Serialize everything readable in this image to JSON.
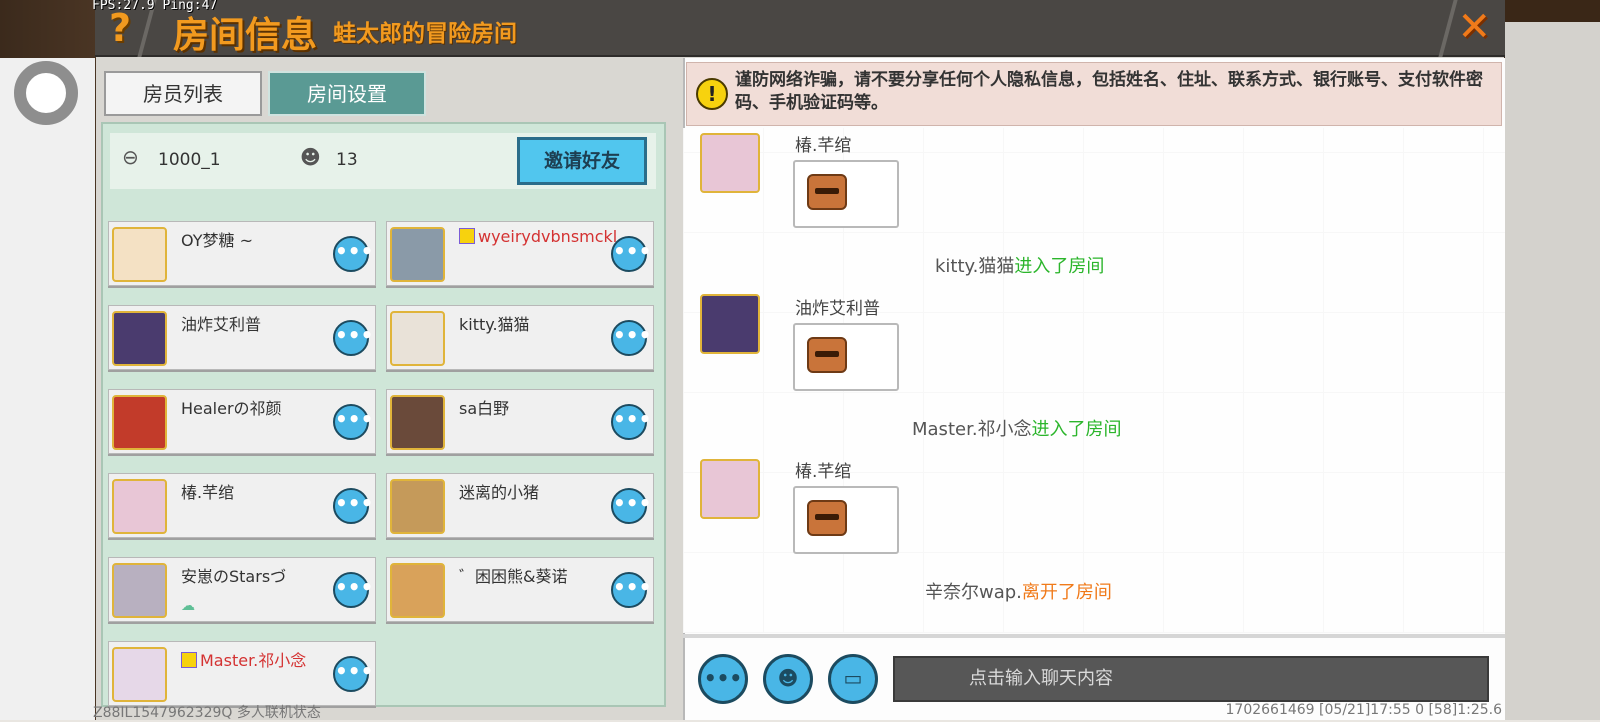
{
  "hud": {
    "fps": "FPS:27.9  Ping:47"
  },
  "titlebar": {
    "help": "?",
    "title": "房间信息",
    "room_name": "蛙太郎的冒险房间",
    "close": "✕"
  },
  "tabs": [
    {
      "label": "房员列表"
    },
    {
      "label": "房间设置"
    }
  ],
  "room_info": {
    "room_id": "1000_1",
    "player_count": "13",
    "invite_label": "邀请好友"
  },
  "members": [
    {
      "name": "OY梦糖 ~",
      "avatar_color": "#f4e1c4",
      "red": false
    },
    {
      "name": "wyeirydvbnsmckl",
      "avatar_color": "#8a9aa8",
      "red": true,
      "badge": "M"
    },
    {
      "name": "油炸艾利普",
      "avatar_color": "#4a3b6e",
      "red": false
    },
    {
      "name": "kitty.猫猫",
      "avatar_color": "#e9e2d8",
      "red": false
    },
    {
      "name": "Healerの祁颜",
      "avatar_color": "#c23b2a",
      "red": false
    },
    {
      "name": "sa白野",
      "avatar_color": "#6a4a3a",
      "red": false
    },
    {
      "name": "椿.芊绾",
      "avatar_color": "#e8c6d6",
      "red": false
    },
    {
      "name": "迷离的小猪",
      "avatar_color": "#c59a5a",
      "red": false
    },
    {
      "name": "安崽のStarsづ",
      "avatar_color": "#b8b0c0",
      "red": false,
      "cloud": true
    },
    {
      "name": "゛困困熊&葵诺",
      "avatar_color": "#d9a25a",
      "red": false
    },
    {
      "name": "Master.祁小念",
      "avatar_color": "#e6d8e8",
      "red": true,
      "badge": "M"
    }
  ],
  "more_label": "•••",
  "warning": {
    "icon": "!",
    "text": "谨防网络诈骗，请不要分享任何个人隐私信息，包括姓名、住址、联系方式、银行账号、支付软件密码、手机验证码等。"
  },
  "chat": {
    "messages": [
      {
        "sender": "椿.芊绾",
        "avatar_color": "#e8c6d6"
      },
      {
        "sender": "油炸艾利普",
        "avatar_color": "#4a3b6e"
      },
      {
        "sender": "椿.芊绾",
        "avatar_color": "#e8c6d6"
      }
    ],
    "system": [
      {
        "user": "kitty.猫猫",
        "action": "进入了房间",
        "type": "in"
      },
      {
        "user": "Master.祁小念",
        "action": "进入了房间",
        "type": "in"
      },
      {
        "user": "辛奈尔wap.",
        "action": "离开了房间",
        "type": "out"
      }
    ],
    "input_placeholder": "点击输入聊天内容",
    "buttons": {
      "more": "•••",
      "emoji": "☻",
      "keyboard": "▭"
    }
  },
  "footer": {
    "left": "Z88IL1547962329Q 多人联机状态",
    "right": "1702661469   [05/21]17:55 0   [58]1:25.6"
  },
  "colors": {
    "accent_orange": "#f29a1f",
    "blue_button": "#49b6e6",
    "tab_active": "#5a9a94",
    "panel_green": "#cfe6d8"
  }
}
